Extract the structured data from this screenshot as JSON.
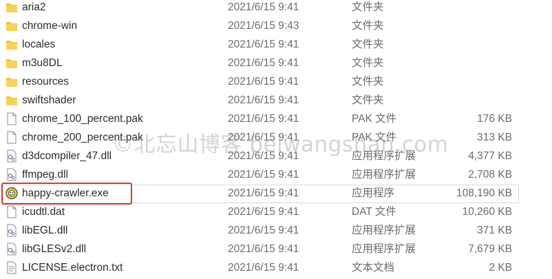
{
  "files": [
    {
      "name": "aria2",
      "date": "2021/6/15 9:41",
      "type": "文件夹",
      "size": "",
      "icon": "folder-icon"
    },
    {
      "name": "chrome-win",
      "date": "2021/6/15 9:43",
      "type": "文件夹",
      "size": "",
      "icon": "folder-icon"
    },
    {
      "name": "locales",
      "date": "2021/6/15 9:41",
      "type": "文件夹",
      "size": "",
      "icon": "folder-icon"
    },
    {
      "name": "m3u8DL",
      "date": "2021/6/15 9:41",
      "type": "文件夹",
      "size": "",
      "icon": "folder-icon"
    },
    {
      "name": "resources",
      "date": "2021/6/15 9:41",
      "type": "文件夹",
      "size": "",
      "icon": "folder-icon"
    },
    {
      "name": "swiftshader",
      "date": "2021/6/15 9:41",
      "type": "文件夹",
      "size": "",
      "icon": "folder-icon"
    },
    {
      "name": "chrome_100_percent.pak",
      "date": "2021/6/15 9:41",
      "type": "PAK 文件",
      "size": "176 KB",
      "icon": "file-icon"
    },
    {
      "name": "chrome_200_percent.pak",
      "date": "2021/6/15 9:41",
      "type": "PAK 文件",
      "size": "313 KB",
      "icon": "file-icon"
    },
    {
      "name": "d3dcompiler_47.dll",
      "date": "2021/6/15 9:41",
      "type": "应用程序扩展",
      "size": "4,377 KB",
      "icon": "dll-icon"
    },
    {
      "name": "ffmpeg.dll",
      "date": "2021/6/15 9:41",
      "type": "应用程序扩展",
      "size": "2,708 KB",
      "icon": "dll-icon"
    },
    {
      "name": "happy-crawler.exe",
      "date": "2021/6/15 9:41",
      "type": "应用程序",
      "size": "108,190 KB",
      "icon": "app-icon"
    },
    {
      "name": "icudtl.dat",
      "date": "2021/6/15 9:41",
      "type": "DAT 文件",
      "size": "10,260 KB",
      "icon": "file-icon"
    },
    {
      "name": "libEGL.dll",
      "date": "2021/6/15 9:41",
      "type": "应用程序扩展",
      "size": "371 KB",
      "icon": "dll-icon"
    },
    {
      "name": "libGLESv2.dll",
      "date": "2021/6/15 9:41",
      "type": "应用程序扩展",
      "size": "7,679 KB",
      "icon": "dll-icon"
    },
    {
      "name": "LICENSE.electron.txt",
      "date": "2021/6/15 9:41",
      "type": "文本文档",
      "size": "2 KB",
      "icon": "text-file-icon"
    }
  ],
  "watermark": "©北忘山博客 beiwangshan.com",
  "colors": {
    "highlight": "#d63a3a",
    "folder": "#f2c23f"
  }
}
